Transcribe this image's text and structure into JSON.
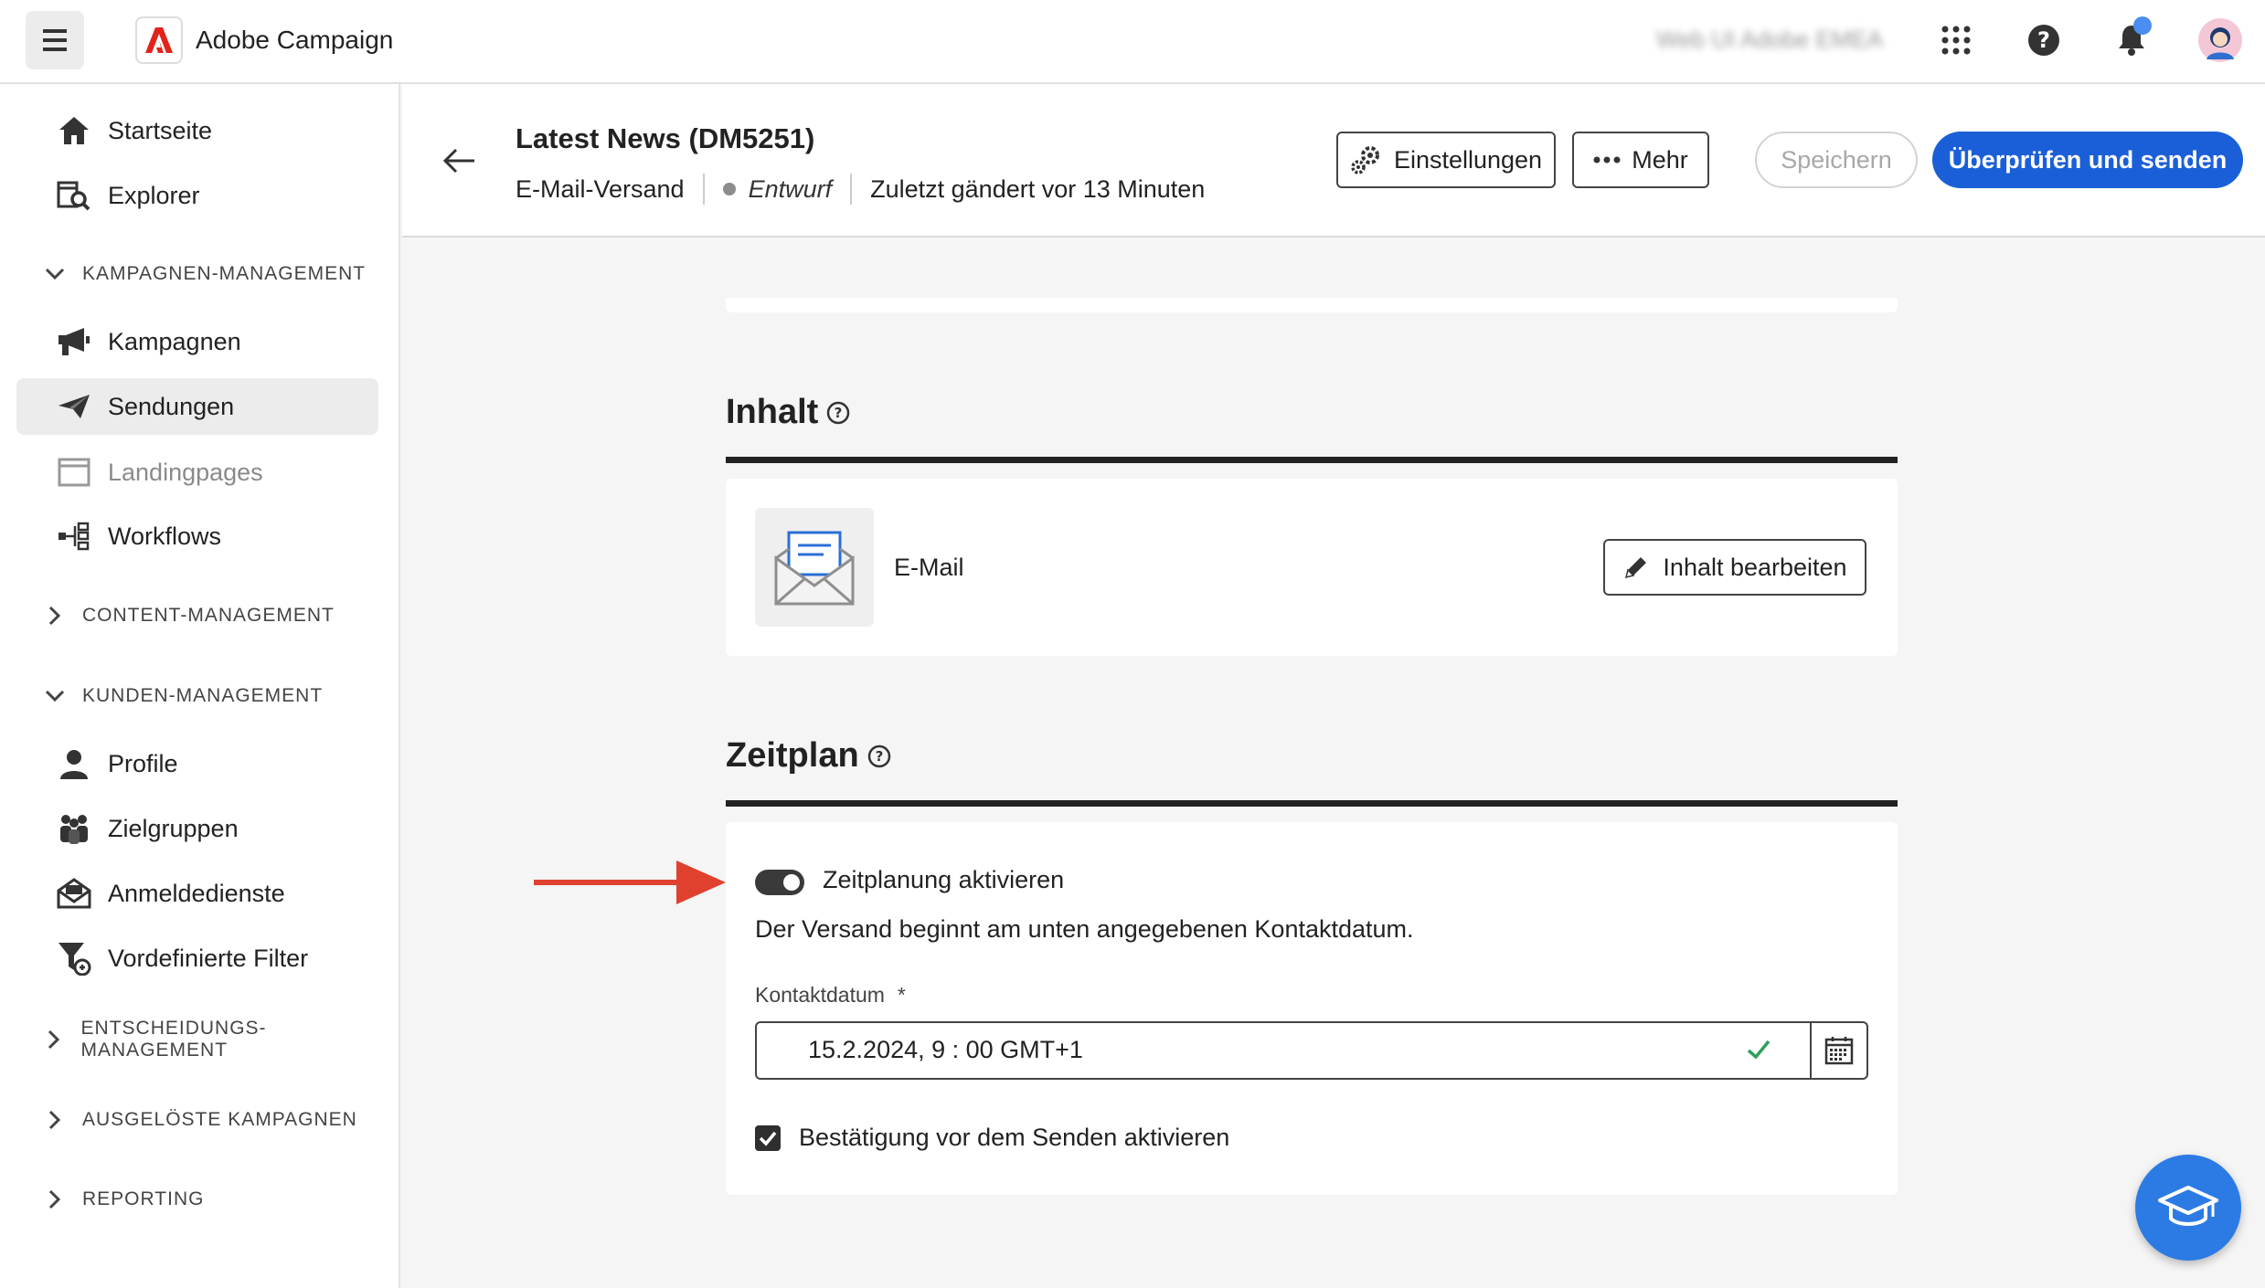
{
  "app": {
    "title": "Adobe Campaign",
    "org": "Web UI Adobe EMEA"
  },
  "sidebar": {
    "items": [
      {
        "label": "Startseite",
        "icon": "home-icon"
      },
      {
        "label": "Explorer",
        "icon": "explorer-icon"
      }
    ],
    "sections": {
      "kampagnen": {
        "label": "KAMPAGNEN-MANAGEMENT",
        "expanded": true
      },
      "content": {
        "label": "CONTENT-MANAGEMENT",
        "expanded": false
      },
      "kunden": {
        "label": "KUNDEN-MANAGEMENT",
        "expanded": true
      },
      "entscheidung": {
        "label": "ENTSCHEIDUNGS- MANAGEMENT",
        "expanded": false
      },
      "ausgeloest": {
        "label": "AUSGELÖSTE KAMPAGNEN",
        "expanded": false
      },
      "reporting": {
        "label": "REPORTING",
        "expanded": false
      }
    },
    "kampagnen_items": [
      {
        "label": "Kampagnen"
      },
      {
        "label": "Sendungen",
        "active": true
      },
      {
        "label": "Landingpages",
        "disabled": true
      },
      {
        "label": "Workflows"
      }
    ],
    "kunden_items": [
      {
        "label": "Profile"
      },
      {
        "label": "Zielgruppen"
      },
      {
        "label": "Anmeldedienste"
      },
      {
        "label": "Vordefinierte Filter"
      }
    ]
  },
  "header": {
    "title": "Latest News (DM5251)",
    "type": "E-Mail-Versand",
    "status": "Entwurf",
    "modified": "Zuletzt gändert vor 13 Minuten",
    "settings_label": "Einstellungen",
    "more_label": "Mehr",
    "save_label": "Speichern",
    "review_label": "Überprüfen und senden"
  },
  "content_section": {
    "title": "Inhalt",
    "channel_label": "E-Mail",
    "edit_label": "Inhalt bearbeiten"
  },
  "schedule_section": {
    "title": "Zeitplan",
    "toggle_label": "Zeitplanung aktivieren",
    "toggle_on": true,
    "description": "Der Versand beginnt am unten angegebenen Kontaktdatum.",
    "date_label": "Kontaktdatum",
    "required_mark": "*",
    "date_value": "15.2.2024,  9 : 00  GMT+1",
    "confirm_label": "Bestätigung vor dem Senden aktivieren",
    "confirm_checked": true
  },
  "colors": {
    "primary": "#1b5fd8",
    "annotation_arrow": "#e0402e",
    "valid_check": "#2f9e5b",
    "fab": "#2c7be5"
  }
}
